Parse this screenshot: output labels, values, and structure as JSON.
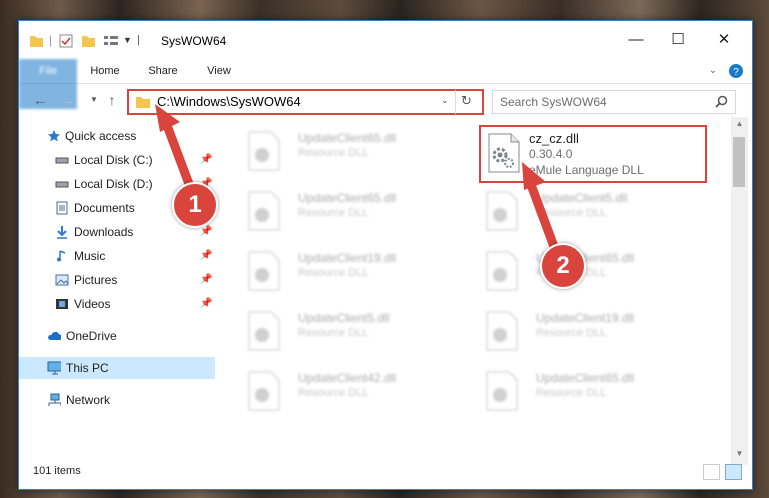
{
  "window": {
    "title": "SysWOW64"
  },
  "ribbon": {
    "tabs": [
      "File",
      "Home",
      "Share",
      "View"
    ]
  },
  "address": {
    "path": "C:\\Windows\\SysWOW64"
  },
  "search": {
    "placeholder": "Search SysWOW64"
  },
  "sidebar": {
    "items": [
      {
        "label": "Quick access",
        "icon": "star-icon"
      },
      {
        "label": "Local Disk (C:)",
        "icon": "drive-icon"
      },
      {
        "label": "Local Disk (D:)",
        "icon": "drive-icon"
      },
      {
        "label": "Documents",
        "icon": "documents-icon"
      },
      {
        "label": "Downloads",
        "icon": "download-icon"
      },
      {
        "label": "Music",
        "icon": "music-icon"
      },
      {
        "label": "Pictures",
        "icon": "pictures-icon"
      },
      {
        "label": "Videos",
        "icon": "videos-icon"
      },
      {
        "label": "OneDrive",
        "icon": "cloud-icon"
      },
      {
        "label": "This PC",
        "icon": "computer-icon"
      },
      {
        "label": "Network",
        "icon": "network-icon"
      }
    ]
  },
  "files": [
    {
      "name": "UpdateClient65.dll",
      "type": "Resource DLL"
    },
    {
      "name": "UpdateClient65.dll",
      "type": "Resource DLL"
    },
    {
      "name": "UpdateClient5.dll",
      "type": "Resource DLL"
    },
    {
      "name": "UpdateClient19.dll",
      "type": "Resource DLL"
    },
    {
      "name": "UpdateClient65.dll",
      "type": "Resource DLL"
    },
    {
      "name": "UpdateClient5.dll",
      "type": "Resource DLL"
    },
    {
      "name": "UpdateClient19.dll",
      "type": "Resource DLL"
    },
    {
      "name": "UpdateClient42.dll",
      "type": "Resource DLL"
    },
    {
      "name": "UpdateClient65.dll",
      "type": "Resource DLL"
    }
  ],
  "highlighted_file": {
    "name": "cz_cz.dll",
    "version": "0.30.4.0",
    "description": "eMule Language DLL"
  },
  "status": {
    "items": "101 items"
  },
  "annotations": {
    "step1": "1",
    "step2": "2"
  },
  "colors": {
    "accent": "#1979ca",
    "highlight": "#d9443c",
    "selection": "#cce8ff"
  }
}
